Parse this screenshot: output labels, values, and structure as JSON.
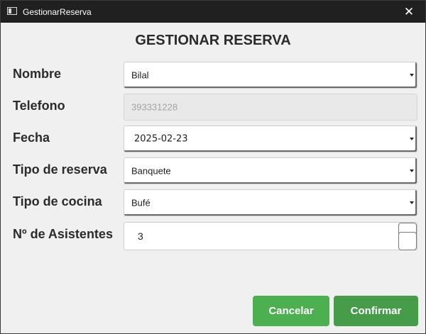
{
  "window": {
    "title": "GestionarReserva",
    "close_glyph": "✕"
  },
  "form": {
    "heading": "GESTIONAR RESERVA",
    "nombre": {
      "label": "Nombre",
      "value": "Bilal"
    },
    "telefono": {
      "label": "Telefono",
      "value": "393331228"
    },
    "fecha": {
      "label": "Fecha",
      "value": "2025-02-23"
    },
    "tipo_reserva": {
      "label": "Tipo de reserva",
      "value": "Banquete"
    },
    "tipo_cocina": {
      "label": "Tipo de cocina",
      "value": "Bufé"
    },
    "asistentes": {
      "label": "Nº de Asistentes",
      "value": "3"
    }
  },
  "actions": {
    "cancel_label": "Cancelar",
    "confirm_label": "Confirmar"
  },
  "colors": {
    "button_green": "#4caf50",
    "titlebar": "#202020",
    "window_bg": "#f0f0f0"
  },
  "icons": {
    "app": "app-window-icon",
    "close": "close-icon",
    "dropdown": "chevron-down-icon"
  }
}
